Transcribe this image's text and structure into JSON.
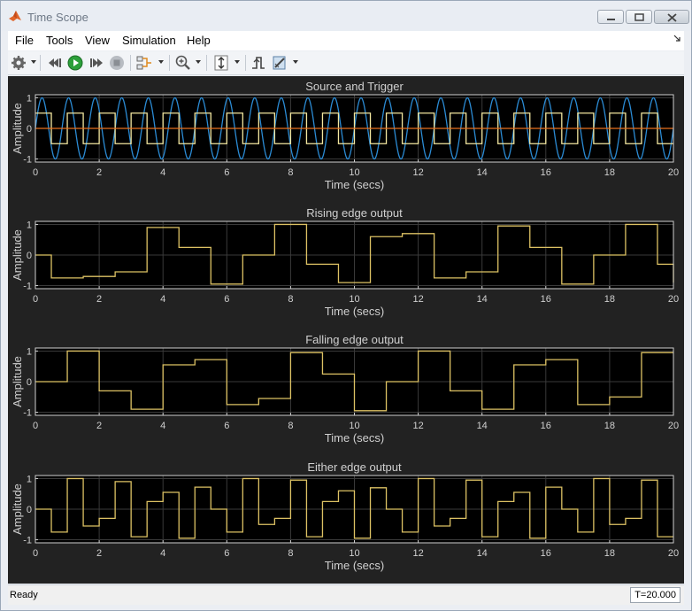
{
  "window": {
    "title": "Time Scope",
    "controls": [
      "minimize-icon",
      "maximize-icon",
      "close-icon"
    ]
  },
  "menu": {
    "items": [
      "File",
      "Tools",
      "View",
      "Simulation",
      "Help"
    ],
    "dock_icon": "dock-arrow-icon"
  },
  "toolbar": {
    "icons": [
      "gear-icon",
      "step-back-icon",
      "run-icon",
      "step-forward-icon",
      "stop-icon",
      "signal-select-icon",
      "zoom-in-icon",
      "scale-axes-icon",
      "trigger-icon",
      "measurements-icon"
    ]
  },
  "colors": {
    "plot_background": "#000000",
    "figure_background": "#222222",
    "axes_and_text": "#d0d0d0",
    "grid": "#3a3a3a",
    "sine": "#2b8bd4",
    "square": "#f3e7a0",
    "horizontal_line": "#e8701e",
    "edge_outputs": "#ddc264"
  },
  "status": {
    "state": "Ready",
    "time": "T=20.000"
  },
  "chart_data": [
    {
      "type": "line",
      "title": "Source and Trigger",
      "xlabel": "Time (secs)",
      "ylabel": "Amplitude",
      "xlim": [
        0,
        20
      ],
      "ylim": [
        -1.1,
        1.1
      ],
      "x_ticks": [
        "0",
        "2",
        "4",
        "6",
        "8",
        "10",
        "12",
        "14",
        "16",
        "18",
        "20"
      ],
      "y_ticks": [
        "1",
        "0",
        "-1"
      ],
      "y_tick_values": [
        1,
        0,
        -1
      ],
      "grid": true,
      "series": [
        {
          "kind": "sine",
          "frequency_hz": 1.2,
          "amplitude": 1,
          "color": "#2b8bd4"
        },
        {
          "kind": "square",
          "period_s": 1,
          "high": 0.5,
          "low": -0.5,
          "duty": 0.5,
          "color": "#f3e7a0"
        },
        {
          "kind": "constant",
          "value": 0,
          "color": "#e8701e"
        }
      ]
    },
    {
      "type": "line",
      "title": "Rising edge output",
      "xlabel": "Time (secs)",
      "ylabel": "Amplitude",
      "xlim": [
        0,
        20
      ],
      "ylim": [
        -1.1,
        1.1
      ],
      "x_ticks": [
        "0",
        "2",
        "4",
        "6",
        "8",
        "10",
        "12",
        "14",
        "16",
        "18",
        "20"
      ],
      "y_ticks": [
        "1",
        "0",
        "-1"
      ],
      "y_tick_values": [
        1,
        0,
        -1
      ],
      "grid": true,
      "series": [
        {
          "kind": "step",
          "color": "#ddc264",
          "x": [
            0,
            0.5,
            1.5,
            2.5,
            3.5,
            4.5,
            5.5,
            6.5,
            7.5,
            8.5,
            9.5,
            10.5,
            11.5,
            12.5,
            13.5,
            14.5,
            15.5,
            16.5,
            17.5,
            18.5,
            19.5,
            20
          ],
          "y": [
            0,
            -0.75,
            -0.7,
            -0.55,
            0.9,
            0.25,
            -0.95,
            0,
            1,
            -0.3,
            -0.9,
            0.6,
            0.7,
            -0.75,
            -0.55,
            0.95,
            0.25,
            -0.95,
            0,
            1,
            -0.3,
            -0.9
          ]
        }
      ]
    },
    {
      "type": "line",
      "title": "Falling edge output",
      "xlabel": "Time (secs)",
      "ylabel": "Amplitude",
      "xlim": [
        0,
        20
      ],
      "ylim": [
        -1.1,
        1.1
      ],
      "x_ticks": [
        "0",
        "2",
        "4",
        "6",
        "8",
        "10",
        "12",
        "14",
        "16",
        "18",
        "20"
      ],
      "y_ticks": [
        "1",
        "0",
        "-1"
      ],
      "y_tick_values": [
        1,
        0,
        -1
      ],
      "grid": true,
      "series": [
        {
          "kind": "step",
          "color": "#ddc264",
          "x": [
            0,
            1,
            2,
            3,
            4,
            5,
            6,
            7,
            8,
            9,
            10,
            11,
            12,
            13,
            14,
            15,
            16,
            17,
            18,
            19,
            20
          ],
          "y": [
            0,
            1,
            -0.3,
            -0.9,
            0.55,
            0.72,
            -0.75,
            -0.55,
            0.95,
            0.25,
            -0.95,
            0,
            1,
            -0.3,
            -0.9,
            0.55,
            0.72,
            -0.75,
            -0.5,
            0.95,
            0.95
          ]
        }
      ]
    },
    {
      "type": "line",
      "title": "Either edge output",
      "xlabel": "Time (secs)",
      "ylabel": "Amplitude",
      "xlim": [
        0,
        20
      ],
      "ylim": [
        -1.1,
        1.1
      ],
      "x_ticks": [
        "0",
        "2",
        "4",
        "6",
        "8",
        "10",
        "12",
        "14",
        "16",
        "18",
        "20"
      ],
      "y_ticks": [
        "1",
        "0",
        "-1"
      ],
      "y_tick_values": [
        1,
        0,
        -1
      ],
      "grid": true,
      "series": [
        {
          "kind": "step",
          "color": "#ddc264",
          "x": [
            0,
            0.5,
            1,
            1.5,
            2,
            2.5,
            3,
            3.5,
            4,
            4.5,
            5,
            5.5,
            6,
            6.5,
            7,
            7.5,
            8,
            8.5,
            9,
            9.5,
            10,
            10.5,
            11,
            11.5,
            12,
            12.5,
            13,
            13.5,
            14,
            14.5,
            15,
            15.5,
            16,
            16.5,
            17,
            17.5,
            18,
            18.5,
            19,
            19.5,
            20
          ],
          "y": [
            0,
            -0.75,
            1,
            -0.55,
            -0.3,
            0.9,
            -0.9,
            0.25,
            0.55,
            -0.95,
            0.72,
            0,
            -0.75,
            1,
            -0.5,
            -0.3,
            0.95,
            -0.9,
            0.25,
            0.6,
            -0.95,
            0.7,
            0,
            -0.75,
            1,
            -0.55,
            -0.3,
            0.95,
            -0.9,
            0.25,
            0.55,
            -0.95,
            0.72,
            0,
            -0.75,
            1,
            -0.5,
            -0.3,
            0.95,
            -0.9,
            -0.9
          ]
        }
      ]
    }
  ]
}
